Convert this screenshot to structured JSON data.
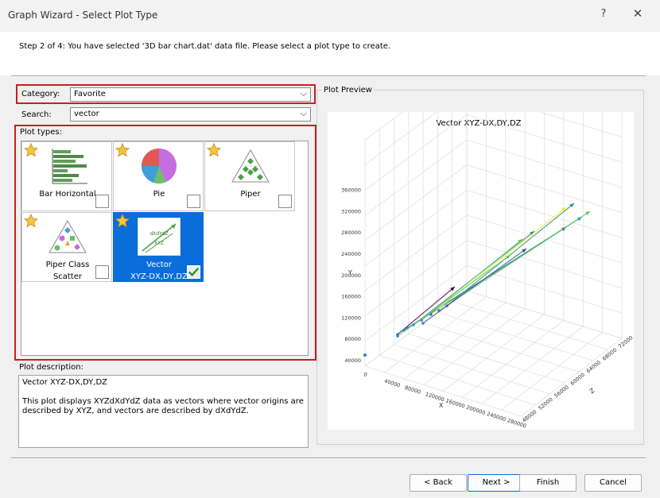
{
  "window": {
    "title": "Graph Wizard - Select Plot Type",
    "help_glyph": "?",
    "close_glyph": "✕"
  },
  "header": {
    "step_text": "Step 2 of 4:  You have selected '3D bar chart.dat' data file. Please select a plot type to create."
  },
  "category": {
    "label": "Category:",
    "value": "Favorite"
  },
  "search": {
    "label": "Search:",
    "value": "vector"
  },
  "plot_types": {
    "label": "Plot types:",
    "items": [
      {
        "name": "Bar Horizontal",
        "favorite": true,
        "checked": false,
        "selected": false
      },
      {
        "name": "Pie",
        "favorite": true,
        "checked": false,
        "selected": false
      },
      {
        "name": "Piper",
        "favorite": true,
        "checked": false,
        "selected": false
      },
      {
        "name_line1": "Piper Class",
        "name_line2": "Scatter",
        "favorite": true,
        "checked": false,
        "selected": false
      },
      {
        "name_line1": "Vector",
        "name_line2": "XYZ-DX,DY,DZ",
        "favorite": true,
        "checked": true,
        "selected": true
      }
    ]
  },
  "description": {
    "label": "Plot description:",
    "line1": "Vector XYZ-DX,DY,DZ",
    "line2": "This plot displays XYZdXdYdZ data as vectors where vector origins are",
    "line3": "described by XYZ, and vectors are described by dXdYdZ."
  },
  "preview": {
    "label": "Plot Preview",
    "chart_title": "Vector XYZ-DX,DY,DZ",
    "thumb_text": "dXdYdZ",
    "thumb_text2": "XYZ"
  },
  "chart_data": {
    "type": "scatter",
    "title": "Vector XYZ-DX,DY,DZ",
    "xlabel": "X",
    "ylabel": "Y",
    "zlabel": "Z",
    "x_ticks": [
      "0",
      "40000",
      "80000",
      "120000",
      "160000",
      "200000",
      "240000",
      "280000"
    ],
    "y_ticks": [
      "40000",
      "80000",
      "120000",
      "160000",
      "200000",
      "240000",
      "280000",
      "320000",
      "360000"
    ],
    "z_ticks": [
      "48000",
      "52000",
      "56000",
      "60000",
      "64000",
      "68000",
      "72000"
    ],
    "grid": true,
    "series_colors": [
      "#440154",
      "#3b528b",
      "#21918c",
      "#5ec962",
      "#fde725"
    ]
  },
  "buttons": {
    "back": "< Back",
    "next": "Next >",
    "finish": "Finish",
    "cancel": "Cancel"
  },
  "colors": {
    "highlight": "#d3191f",
    "selection": "#0a6dd9"
  }
}
